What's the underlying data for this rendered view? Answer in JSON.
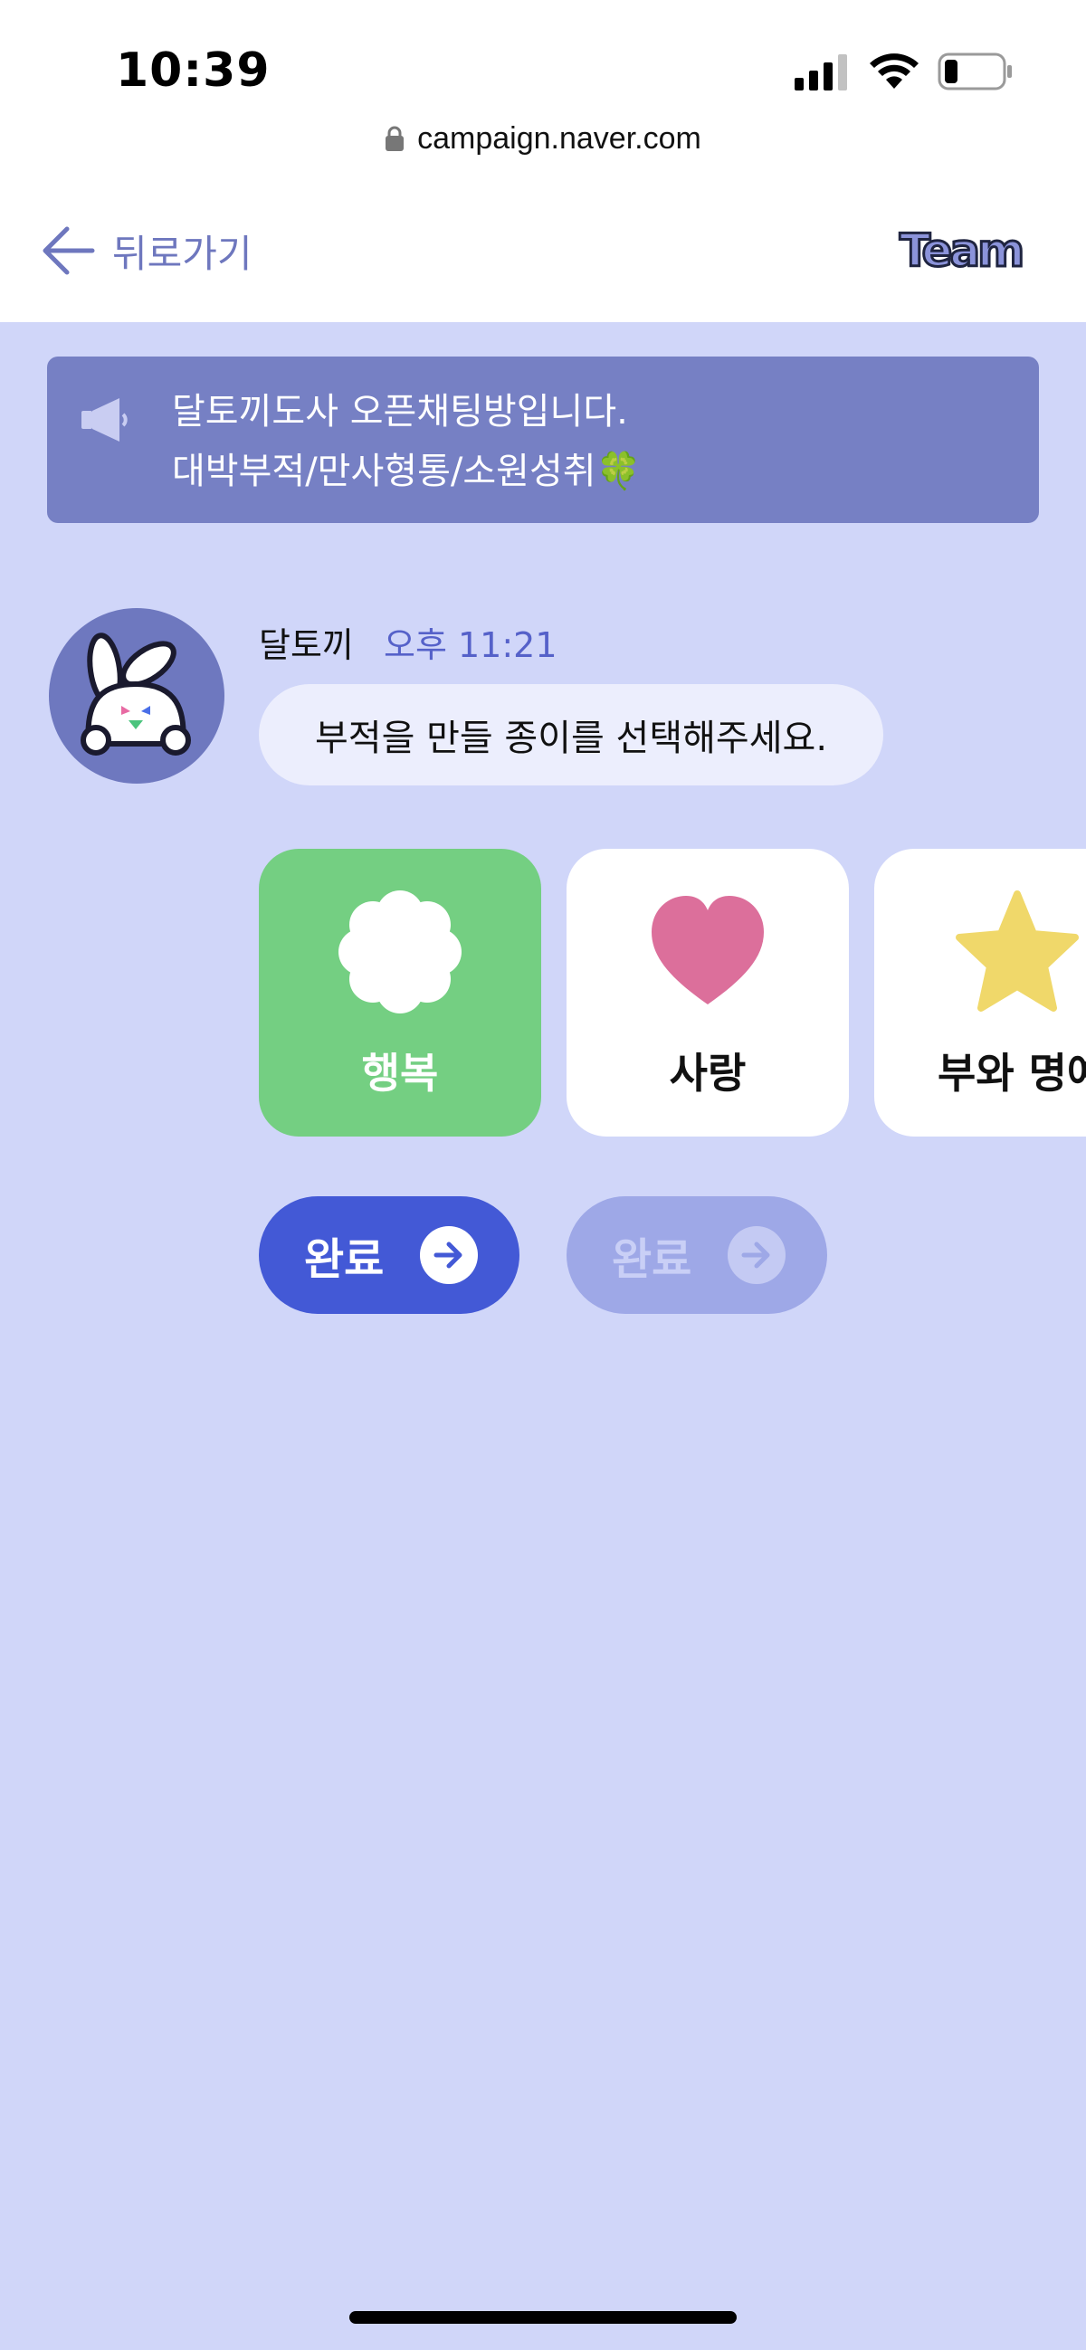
{
  "status_bar": {
    "time": "10:39",
    "url": "campaign.naver.com"
  },
  "nav": {
    "back_label": "뒤로가기",
    "logo_text": "Team"
  },
  "notice": {
    "line1": "달토끼도사 오픈채팅방입니다.",
    "line2": "대박부적/만사형통/소원성취🍀"
  },
  "chat": {
    "sender": "달토끼",
    "time": "오후 11:21",
    "message": "부적을 만들 종이를 선택해주세요."
  },
  "cards": [
    {
      "label": "행복",
      "icon": "clover-icon",
      "selected": true,
      "color": "#74cf82"
    },
    {
      "label": "사랑",
      "icon": "heart-icon",
      "selected": false,
      "color": "#dc6f9b"
    },
    {
      "label": "부와 명예",
      "icon": "star-icon",
      "selected": false,
      "color": "#f0d86a"
    }
  ],
  "buttons": {
    "primary_label": "완료",
    "disabled_label": "완료"
  },
  "colors": {
    "background": "#d0d6f9",
    "accent": "#4359d6",
    "notice": "#7680c4"
  }
}
